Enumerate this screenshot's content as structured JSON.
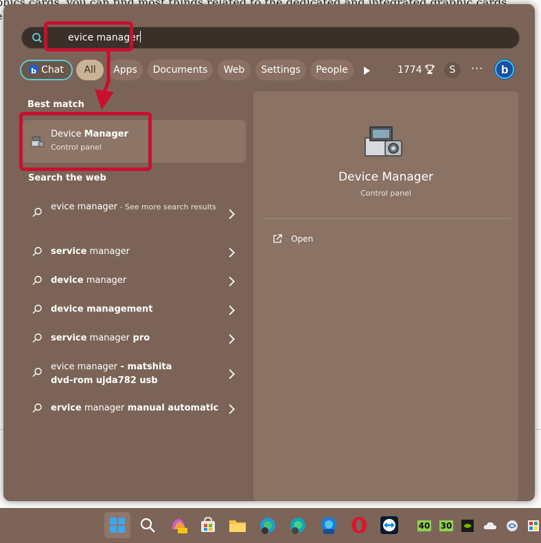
{
  "search": {
    "query": "evice manager"
  },
  "filters": {
    "chat": "Chat",
    "all": "All",
    "apps": "Apps",
    "documents": "Documents",
    "web": "Web",
    "settings": "Settings",
    "people": "People",
    "points": "1774",
    "avatar_letter": "S",
    "more": "···"
  },
  "best_match": {
    "heading": "Best match",
    "name_prefix": "Device ",
    "name_bold": "Manager",
    "subtitle": "Control panel"
  },
  "web": {
    "heading": "Search the web",
    "items": [
      {
        "plain": "evice manager",
        "bold": "",
        "hint": " - See more search results"
      },
      {
        "plain": "service",
        "bold": "",
        "after": " manager"
      },
      {
        "plain": "device",
        "after": " manager"
      },
      {
        "plain": "device management"
      },
      {
        "plain": "service",
        "after": " manager",
        "after2": " pro"
      },
      {
        "plain": "evice manager",
        "bold": " - matshita dvd-rom ujda782 usb"
      },
      {
        "plain": "ervice",
        "after": " manager",
        "after2": " manual automatic"
      }
    ]
  },
  "preview": {
    "title": "Device Manager",
    "subtitle": "Control panel",
    "open_label": "Open"
  },
  "taskbar": {
    "tray": [
      "40",
      "30"
    ]
  },
  "background_doc": {
    "lines": [
      "phics cards, you can find most things related to the dedicated and integrated graphic cards",
      "e"
    ]
  },
  "colors": {
    "panel": "#7b6457",
    "accent_chat": "#5ec9d8",
    "annotation": "#c8102e",
    "chip_active": "#c9b296"
  }
}
